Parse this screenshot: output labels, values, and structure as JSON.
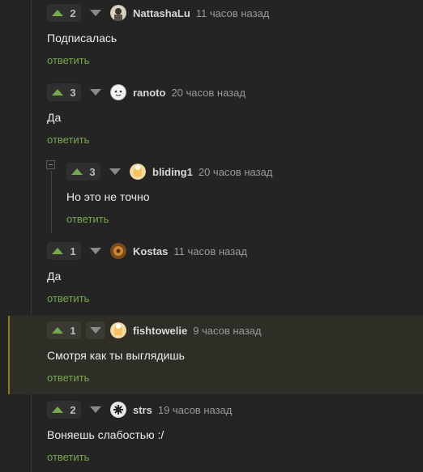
{
  "comments": [
    {
      "votes": "2",
      "username": "NattashaLu",
      "time": "11 часов назад",
      "text": "Подписалась",
      "reply": "ответить"
    },
    {
      "votes": "3",
      "username": "ranoto",
      "time": "20 часов назад",
      "text": "Да",
      "reply": "ответить"
    },
    {
      "votes": "3",
      "username": "bliding1",
      "time": "20 часов назад",
      "text": "Но это не точно",
      "reply": "ответить"
    },
    {
      "votes": "1",
      "username": "Kostas",
      "time": "11 часов назад",
      "text": "Да",
      "reply": "ответить"
    },
    {
      "votes": "1",
      "username": "fishtowelie",
      "time": "9 часов назад",
      "text": "Смотря как ты выглядишь",
      "reply": "ответить"
    },
    {
      "votes": "2",
      "username": "strs",
      "time": "19 часов назад",
      "text": "Воняешь слабостью :/",
      "reply": "ответить"
    }
  ],
  "colors": {
    "accent": "#78a84e",
    "highlight_border": "#8a7a1c",
    "background": "#242424"
  },
  "icons": {
    "up": "vote-up-triangle",
    "down": "vote-down-triangle",
    "collapse": "collapse-minus"
  }
}
